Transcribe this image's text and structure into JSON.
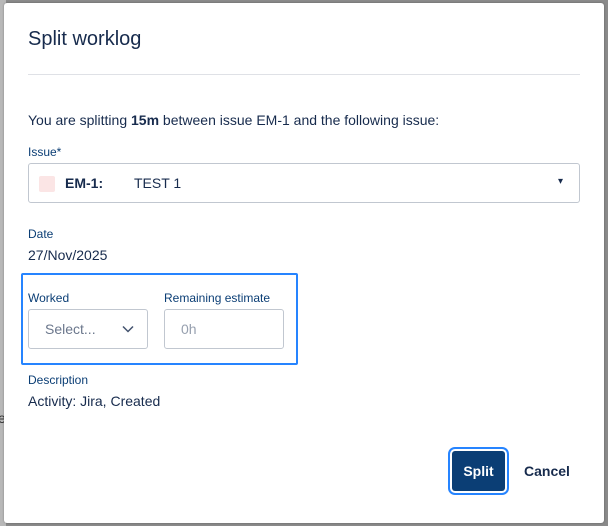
{
  "backdrop": {
    "peek_text": "e"
  },
  "dialog": {
    "title": "Split worklog",
    "intro_prefix": "You are splitting ",
    "intro_amount": "15m",
    "intro_suffix": " between issue EM-1 and the following issue:",
    "issue": {
      "label": "Issue*",
      "key": "EM-1:",
      "summary": "TEST 1",
      "caret": "▾",
      "swatch_color": "#fbe5e5"
    },
    "date": {
      "label": "Date",
      "value": "27/Nov/2025"
    },
    "worked": {
      "label": "Worked",
      "placeholder": "Select..."
    },
    "remaining": {
      "label": "Remaining estimate",
      "placeholder": "0h",
      "value": ""
    },
    "description": {
      "label": "Description",
      "value": "Activity: Jira, Created"
    },
    "actions": {
      "split_label": "Split",
      "cancel_label": "Cancel"
    }
  },
  "colors": {
    "primary": "#0b3e75",
    "focus": "#2684ff",
    "label": "#0b3e75",
    "text": "#172b4d"
  }
}
